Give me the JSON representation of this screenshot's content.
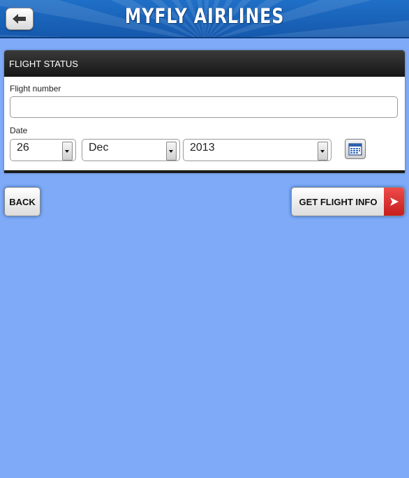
{
  "header": {
    "title": "MYFLY AIRLINES",
    "back_icon": "arrow-left-icon"
  },
  "panel": {
    "heading": "FLIGHT STATUS",
    "flight_number": {
      "label": "Flight number",
      "value": "",
      "placeholder": ""
    },
    "date": {
      "label": "Date",
      "day": "26",
      "month": "Dec",
      "year": "2013",
      "calendar_icon": "calendar-icon"
    }
  },
  "actions": {
    "back_label": "BACK",
    "get_info_label": "GET FLIGHT INFO",
    "get_info_icon": "play-arrow-icon"
  },
  "colors": {
    "background": "#7eaaf7",
    "header": "#1f6fc7",
    "panel_head": "#1a1a1a",
    "accent": "#d62e2e"
  }
}
